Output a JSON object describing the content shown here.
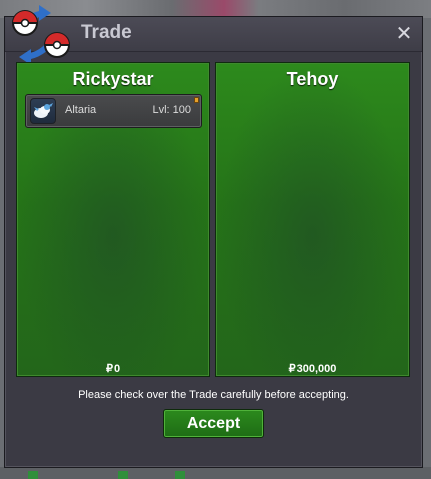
{
  "window": {
    "title": "Trade",
    "close_label": "✕"
  },
  "left_panel": {
    "player_name": "Rickystar",
    "currency_symbol": "₽",
    "money": "0",
    "items": [
      {
        "name": "Altaria",
        "level": "Lvl: 100",
        "icon": "altaria-sprite-icon"
      }
    ]
  },
  "right_panel": {
    "player_name": "Tehoy",
    "currency_symbol": "₽",
    "money": "300,000",
    "items": []
  },
  "footer": {
    "notice": "Please check over the Trade carefully before accepting.",
    "accept_label": "Accept"
  },
  "colors": {
    "panel_green": "#257318",
    "window_bg": "#3b3a44",
    "accept_green": "#2c8a1d"
  }
}
